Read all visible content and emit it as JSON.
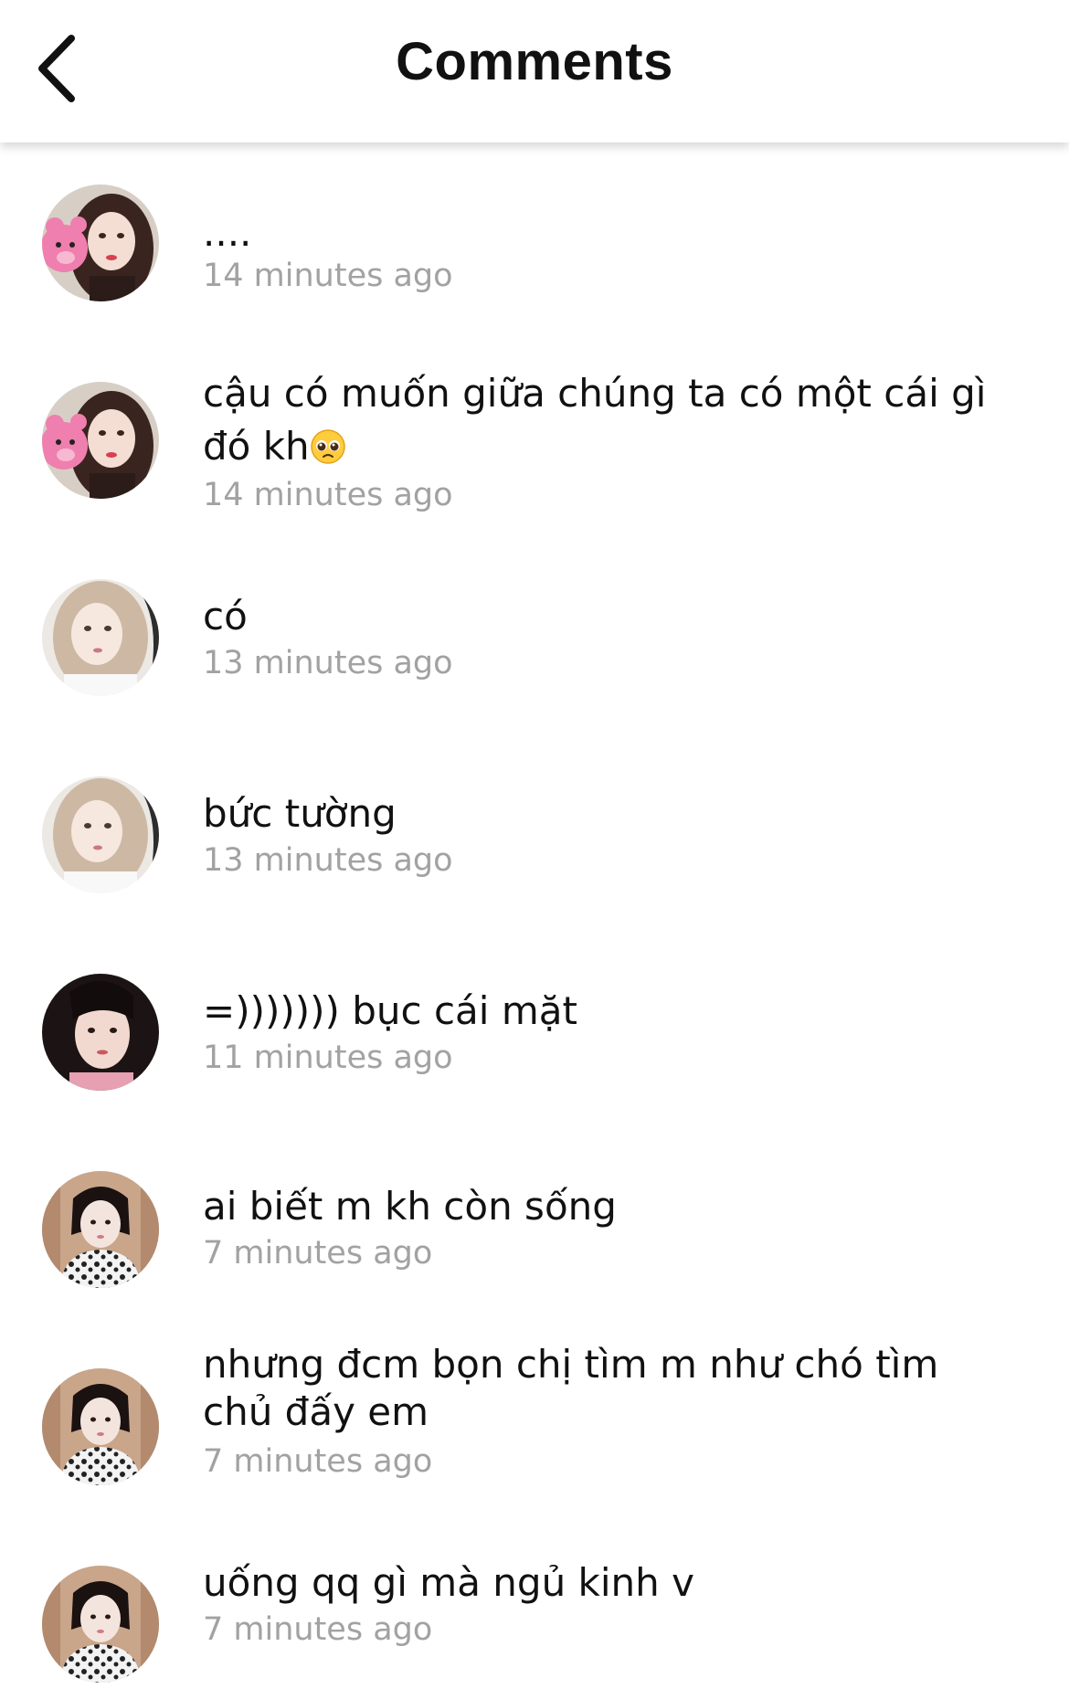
{
  "header": {
    "title": "Comments",
    "back_icon": "chevron-left-icon"
  },
  "comments": [
    {
      "avatar": "avatar-girl-pink-bear",
      "text": "....",
      "time": "14 minutes ago"
    },
    {
      "avatar": "avatar-girl-pink-bear",
      "text": "cậu có muốn giữa chúng ta có một cái gì đó kh",
      "emoji": "pleading-face-icon",
      "time": "14 minutes ago"
    },
    {
      "avatar": "avatar-girl-blonde",
      "text": "có",
      "time": "13 minutes ago"
    },
    {
      "avatar": "avatar-girl-blonde",
      "text": "bức tường",
      "time": "13 minutes ago"
    },
    {
      "avatar": "avatar-girl-dark-hair",
      "text": "=))))))) bục cái mặt",
      "time": "11 minutes ago"
    },
    {
      "avatar": "avatar-girl-pattern-top",
      "text": "ai biết m kh còn sống",
      "time": "7 minutes ago"
    },
    {
      "avatar": "avatar-girl-pattern-top",
      "text": "nhưng đcm bọn chị tìm m như chó tìm chủ đấy em",
      "time": "7 minutes ago"
    },
    {
      "avatar": "avatar-girl-pattern-top",
      "text": "uống qq gì mà ngủ kinh v",
      "time": "7 minutes ago"
    }
  ],
  "colors": {
    "timestamp": "#a2a2a2",
    "text": "#111111",
    "background": "#ffffff"
  }
}
